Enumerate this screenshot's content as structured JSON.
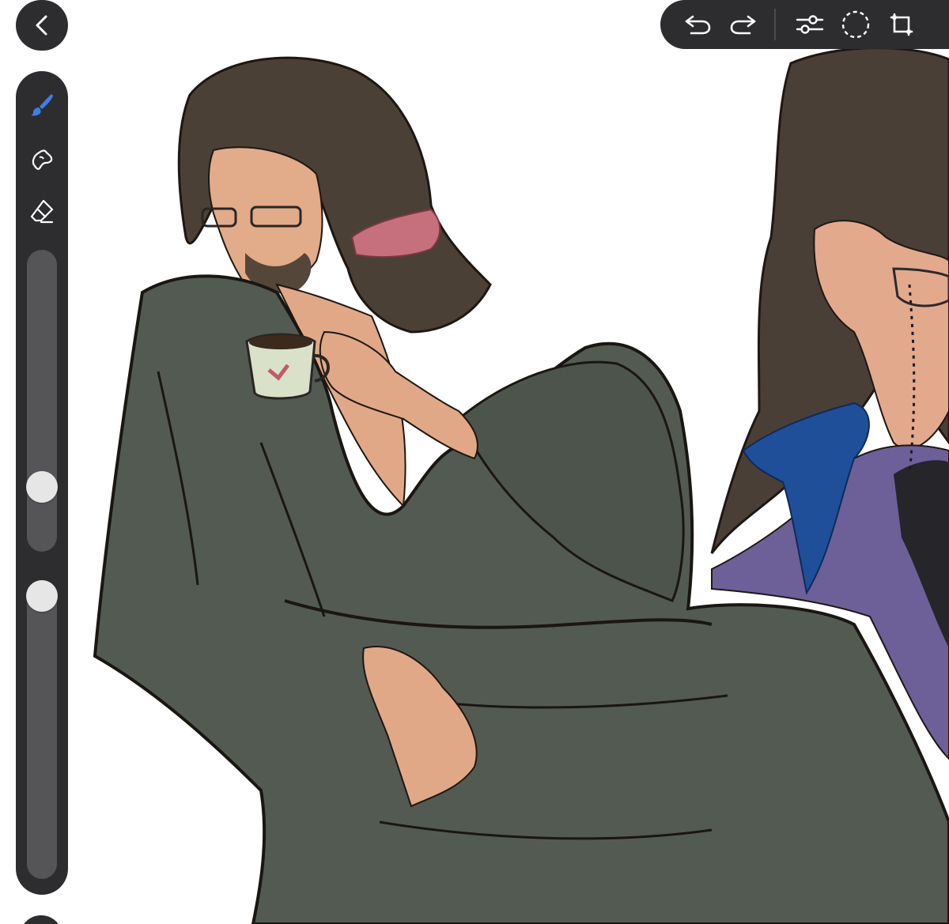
{
  "app": {
    "accent_color": "#3f7ee8",
    "ui_dark": "#2d2d2f"
  },
  "top_toolbar": {
    "icons": [
      "undo-icon",
      "redo-icon",
      "adjustments-icon",
      "selection-icon",
      "transform-icon"
    ]
  },
  "side_bar": {
    "tools": [
      "brush-icon",
      "smudge-icon",
      "eraser-icon"
    ],
    "active_tool": "brush",
    "size_slider": {
      "value": 0.18
    },
    "opacity_slider": {
      "value": 1.0
    }
  }
}
